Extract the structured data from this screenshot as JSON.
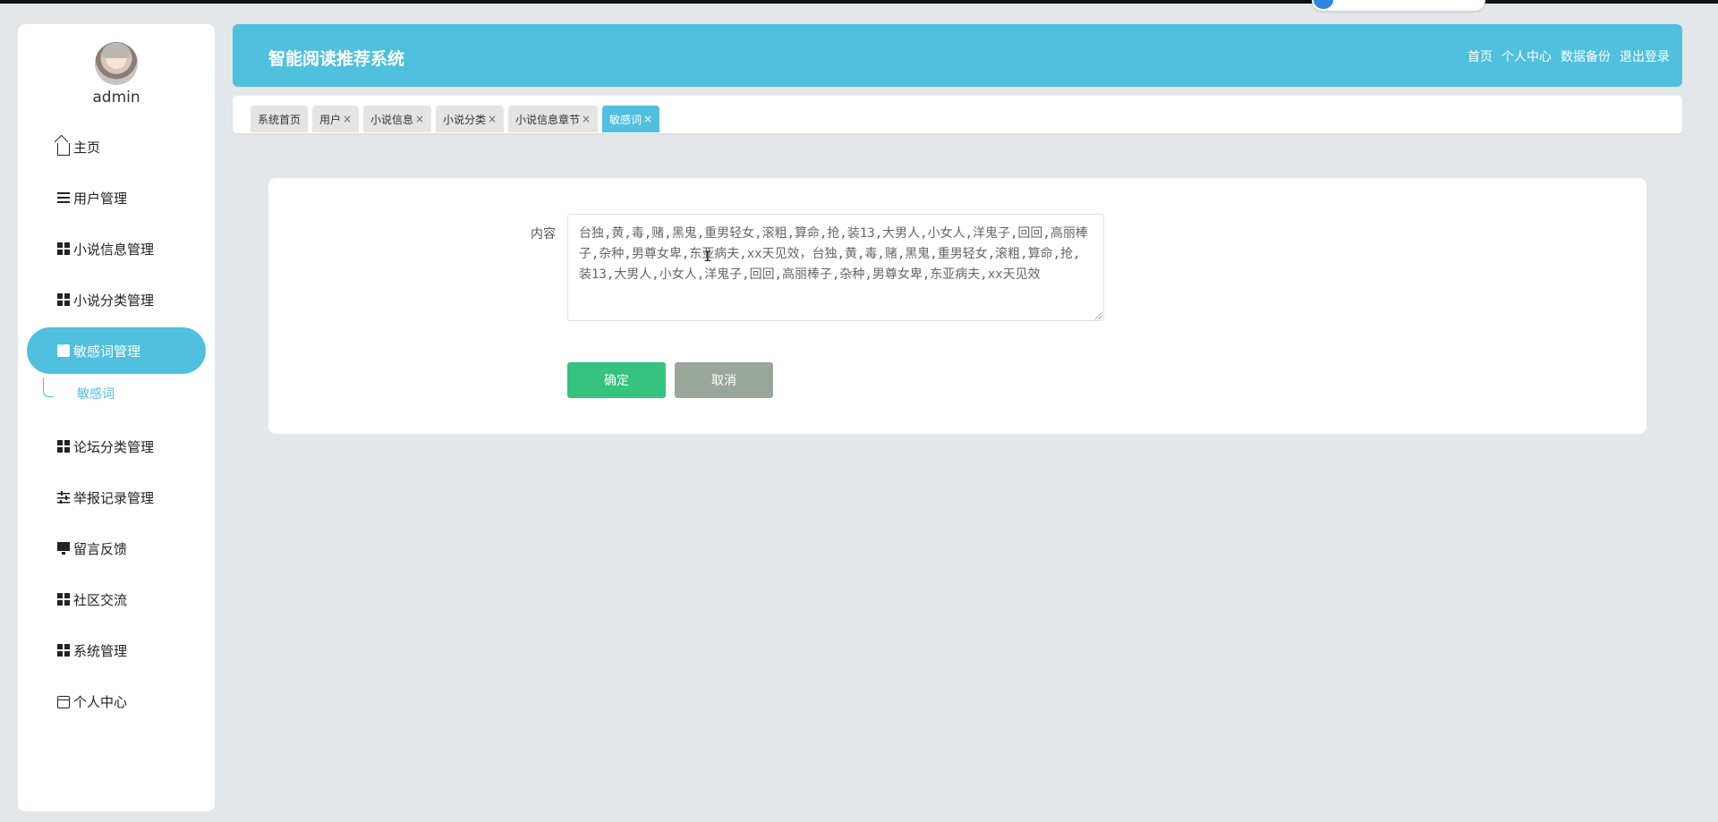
{
  "user": {
    "name": "admin"
  },
  "sidebar": {
    "items": [
      {
        "label": "主页",
        "icon": "home-icon"
      },
      {
        "label": "用户管理",
        "icon": "list-icon"
      },
      {
        "label": "小说信息管理",
        "icon": "grid-icon"
      },
      {
        "label": "小说分类管理",
        "icon": "grid-icon"
      },
      {
        "label": "敏感词管理",
        "icon": "chat-icon"
      },
      {
        "label": "论坛分类管理",
        "icon": "grid-icon"
      },
      {
        "label": "举报记录管理",
        "icon": "sliders-icon"
      },
      {
        "label": "留言反馈",
        "icon": "monitor-icon"
      },
      {
        "label": "社区交流",
        "icon": "grid-icon"
      },
      {
        "label": "系统管理",
        "icon": "grid-icon"
      },
      {
        "label": "个人中心",
        "icon": "card-icon"
      }
    ],
    "sub_item": "敏感词"
  },
  "header": {
    "title": "智能阅读推荐系统",
    "nav": [
      "首页",
      "个人中心",
      "数据备份",
      "退出登录"
    ],
    "accent_color": "#4fc0de"
  },
  "tabs": [
    {
      "label": "系统首页",
      "closable": false
    },
    {
      "label": "用户",
      "closable": true
    },
    {
      "label": "小说信息",
      "closable": true
    },
    {
      "label": "小说分类",
      "closable": true
    },
    {
      "label": "小说信息章节",
      "closable": true
    },
    {
      "label": "敏感词",
      "closable": true
    }
  ],
  "tab_close_glyph": "×",
  "form": {
    "content_label": "内容",
    "content_value": "台独,黄,毒,赌,黑鬼,重男轻女,滚粗,算命,抢,装13,大男人,小女人,洋鬼子,回回,高丽棒子,杂种,男尊女卑,东亚病夫,xx天见效，台独,黄,毒,赌,黑鬼,重男轻女,滚粗,算命,抢,装13,大男人,小女人,洋鬼子,回回,高丽棒子,杂种,男尊女卑,东亚病夫,xx天见效",
    "confirm_label": "确定",
    "cancel_label": "取消",
    "confirm_color": "#35c37f",
    "cancel_color": "#9ba69a"
  }
}
